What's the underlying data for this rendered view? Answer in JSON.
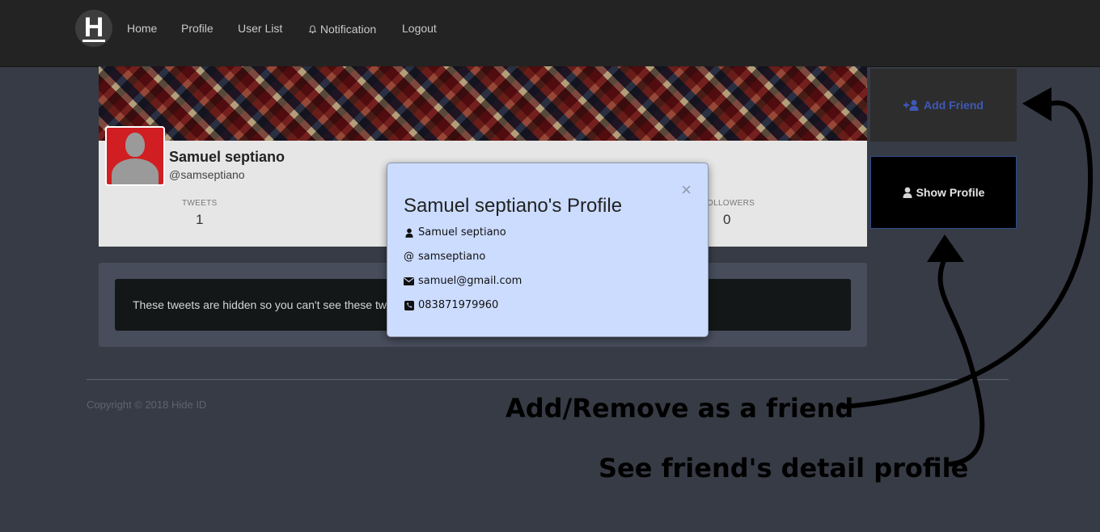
{
  "navbar": {
    "logo": "H",
    "links": [
      "Home",
      "Profile",
      "User List",
      "Notification",
      "Logout"
    ]
  },
  "profile": {
    "name": "Samuel septiano",
    "handle": "@samseptiano",
    "stats": [
      {
        "label": "TWEETS",
        "value": "1"
      },
      {
        "label": "OLLOWERS",
        "value": "0"
      }
    ]
  },
  "tweets_notice": "These tweets are hidden so you can't see these tw",
  "footer": {
    "copyright": "Copyright © 2018 Hide ID"
  },
  "actions": {
    "add_friend": "Add Friend",
    "show_profile": "Show Profile"
  },
  "modal": {
    "close": "×",
    "title": "Samuel septiano's Profile",
    "name": "Samuel septiano",
    "username": "samseptiano",
    "email": "samuel@gmail.com",
    "phone": "083871979960"
  },
  "annotations": {
    "add_remove": "Add/Remove as a friend",
    "see_detail": "See friend's detail profile"
  },
  "colors": {
    "page_bg": "#373b45",
    "navbar_bg": "#232323",
    "add_friend_text": "#3f58b8",
    "modal_bg": "#ccdcff"
  },
  "icons": [
    "user-plus-icon",
    "user-icon",
    "at-icon",
    "envelope-icon",
    "phone-icon",
    "bell-icon",
    "close-icon"
  ]
}
